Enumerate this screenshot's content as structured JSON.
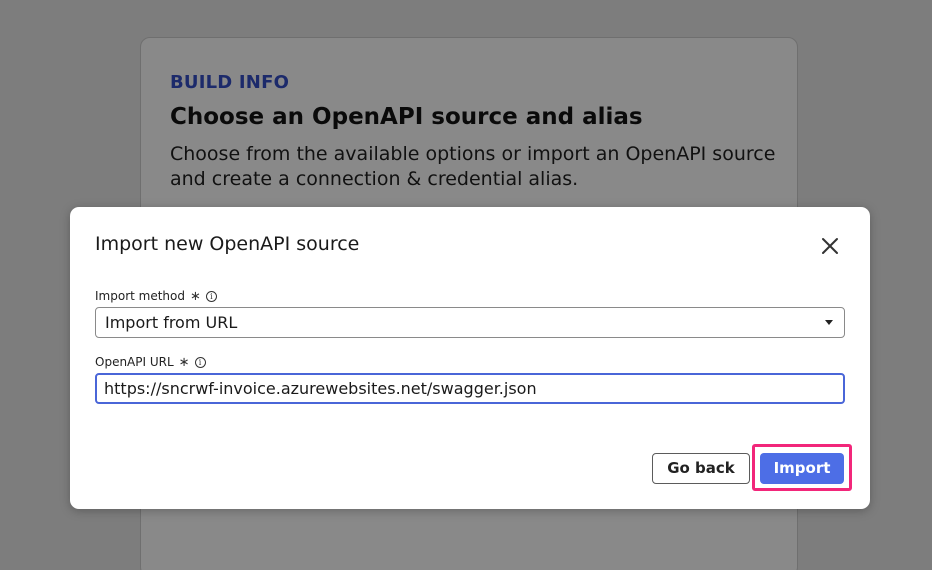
{
  "background": {
    "eyebrow": "BUILD INFO",
    "title": "Choose an OpenAPI source and alias",
    "description": "Choose from the available options or import an OpenAPI source and create a connection & credential alias."
  },
  "modal": {
    "title": "Import new OpenAPI source",
    "close_icon": "close-icon",
    "import_method": {
      "label": "Import method",
      "required_icon": "asterisk-icon",
      "info_icon": "info-icon",
      "selected": "Import from URL"
    },
    "openapi_url": {
      "label": "OpenAPI URL",
      "required_icon": "asterisk-icon",
      "info_icon": "info-icon",
      "value": "https://sncrwf-invoice.azurewebsites.net/swagger.json"
    },
    "buttons": {
      "go_back": "Go back",
      "import": "Import"
    }
  },
  "colors": {
    "overlay": "#7d7d7d",
    "primary": "#4d6ee6",
    "highlight": "#f2267a",
    "eyebrow": "#1c2a6b"
  }
}
